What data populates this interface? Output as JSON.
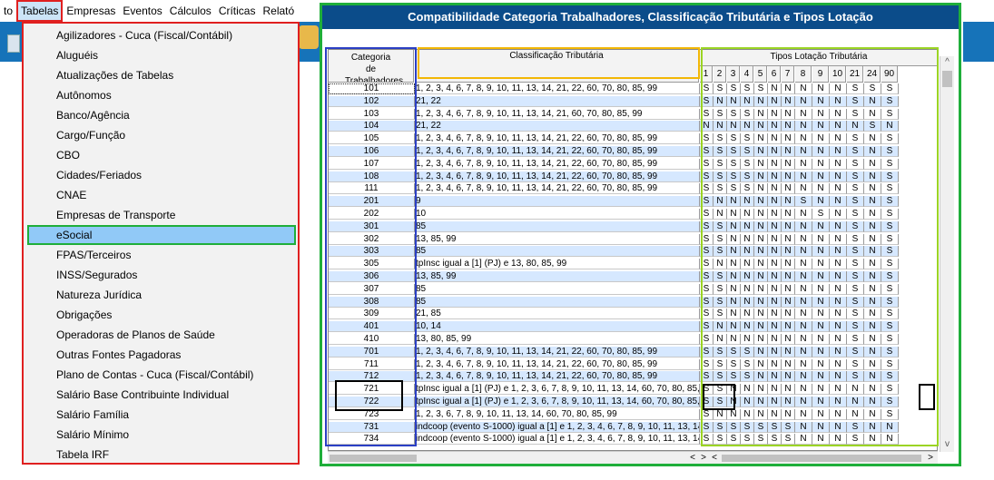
{
  "menubar": {
    "items": [
      "to",
      "Tabelas",
      "Empresas",
      "Eventos",
      "Cálculos",
      "Críticas",
      "Relató"
    ],
    "active": "Tabelas"
  },
  "menu": {
    "items": [
      "Agilizadores - Cuca (Fiscal/Contábil)",
      "Aluguéis",
      "Atualizações de Tabelas",
      "Autônomos",
      "Banco/Agência",
      "Cargo/Função",
      "CBO",
      "Cidades/Feriados",
      "CNAE",
      "Empresas de Transporte",
      "eSocial",
      "FPAS/Terceiros",
      "INSS/Segurados",
      "Natureza Jurídica",
      "Obrigações",
      "Operadoras de Planos de Saúde",
      "Outras Fontes Pagadoras",
      "Plano de Contas - Cuca (Fiscal/Contábil)",
      "Salário Base Contribuinte Individual",
      "Salário Família",
      "Salário Mínimo",
      "Tabela IRF"
    ],
    "selected_index": 10
  },
  "dialog": {
    "title": "Compatibilidade Categoria Trabalhadores, Classificação Tributária e Tipos Lotação",
    "col_categoria": "Categoria de Trabalhadores",
    "col_classificacao": "Classificação Tributária",
    "col_tipos": "Tipos Lotação Tributária",
    "tipos": [
      "1",
      "2",
      "3",
      "4",
      "5",
      "6",
      "7",
      "8",
      "9",
      "10",
      "21",
      "24",
      "90"
    ],
    "rows": [
      {
        "cat": "101",
        "cls": "1, 2, 3, 4, 6, 7, 8, 9, 10, 11, 13, 14, 21, 22, 60, 70, 80, 85, 99",
        "v": "SSSSSNNNNNSSS"
      },
      {
        "cat": "102",
        "cls": "21, 22",
        "v": "SNNNNNNNNNSNS"
      },
      {
        "cat": "103",
        "cls": "1, 2, 3, 4, 6, 7, 8, 9, 10, 11, 13, 14, 21, 60, 70, 80, 85, 99",
        "v": "SSSSNNNNNNSNS"
      },
      {
        "cat": "104",
        "cls": "21, 22",
        "v": "NNNNNNNNNNNSN"
      },
      {
        "cat": "105",
        "cls": "1, 2, 3, 4, 6, 7, 8, 9, 10, 11, 13, 14, 21, 22, 60, 70, 80, 85, 99",
        "v": "SSSSNNNNNNSNS"
      },
      {
        "cat": "106",
        "cls": "1, 2, 3, 4, 6, 7, 8, 9, 10, 11, 13, 14, 21, 22, 60, 70, 80, 85, 99",
        "v": "SSSSNNNNNNSNS"
      },
      {
        "cat": "107",
        "cls": "1, 2, 3, 4, 6, 7, 8, 9, 10, 11, 13, 14, 21, 22, 60, 70, 80, 85, 99",
        "v": "SSSSNNNNNNSNS"
      },
      {
        "cat": "108",
        "cls": "1, 2, 3, 4, 6, 7, 8, 9, 10, 11, 13, 14, 21, 22, 60, 70, 80, 85, 99",
        "v": "SSSSNNNNNNSNS"
      },
      {
        "cat": "111",
        "cls": "1, 2, 3, 4, 6, 7, 8, 9, 10, 11, 13, 14, 21, 22, 60, 70, 80, 85, 99",
        "v": "SSSSNNNNNNSNS"
      },
      {
        "cat": "201",
        "cls": "9",
        "v": "SNNNNNNSNNSNS"
      },
      {
        "cat": "202",
        "cls": "10",
        "v": "SNNNNNNNSNSNS"
      },
      {
        "cat": "301",
        "cls": "85",
        "v": "SSNNNNNNNNSNS"
      },
      {
        "cat": "302",
        "cls": "13, 85, 99",
        "v": "SSNNNNNNNNSNS"
      },
      {
        "cat": "303",
        "cls": "85",
        "v": "SSNNNNNNNNSNS"
      },
      {
        "cat": "305",
        "cls": "tpInsc igual a [1] (PJ) e 13, 80, 85, 99",
        "v": "SNNNNNNNNNSNS"
      },
      {
        "cat": "306",
        "cls": "13, 85, 99",
        "v": "SSNNNNNNNNSNS"
      },
      {
        "cat": "307",
        "cls": "85",
        "v": "SSNNNNNNNNSNS"
      },
      {
        "cat": "308",
        "cls": "85",
        "v": "SSNNNNNNNNSNS"
      },
      {
        "cat": "309",
        "cls": "21, 85",
        "v": "SSNNNNNNNNSNS"
      },
      {
        "cat": "401",
        "cls": "10, 14",
        "v": "SNNNNNNNNNSNS"
      },
      {
        "cat": "410",
        "cls": "13, 80, 85, 99",
        "v": "SNNNNNNNNNSNS"
      },
      {
        "cat": "701",
        "cls": "1, 2, 3, 4, 6, 7, 8, 9, 10, 11, 13, 14, 21, 22, 60, 70, 80, 85, 99",
        "v": "SSSSNNNNNNSNS"
      },
      {
        "cat": "711",
        "cls": "1, 2, 3, 4, 6, 7, 8, 9, 10, 11, 13, 14, 21, 22, 60, 70, 80, 85, 99",
        "v": "SSSSNNNNNNSNS"
      },
      {
        "cat": "712",
        "cls": "1, 2, 3, 4, 6, 7, 8, 9, 10, 11, 13, 14, 21, 22, 60, 70, 80, 85, 99",
        "v": "SSSSNNNNNNSNS"
      },
      {
        "cat": "721",
        "cls": "tpInsc igual a [1] (PJ) e 1, 2, 3, 6, 7, 8, 9, 10, 11, 13, 14, 60, 70, 80, 85, 99",
        "v": "SSNNNNNNNNNNS"
      },
      {
        "cat": "722",
        "cls": "tpInsc igual a [1] (PJ) e 1, 2, 3, 6, 7, 8, 9, 10, 11, 13, 14, 60, 70, 80, 85, 99",
        "v": "SSNNNNNNNNNNS"
      },
      {
        "cat": "723",
        "cls": "1, 2, 3, 6, 7, 8, 9, 10, 11, 13, 14, 60, 70, 80, 85, 99",
        "v": "SNNNNNNNNNNNS"
      },
      {
        "cat": "731",
        "cls": "indcoop (evento S-1000) igual a [1] e 1, 2, 3, 4, 6, 7, 8, 9, 10, 11, 13, 14, 21, 22",
        "v": "SSSSSSSNNNSNN"
      },
      {
        "cat": "734",
        "cls": "indcoop (evento S-1000) igual a [1] e 1, 2, 3, 4, 6, 7, 8, 9, 10, 11, 13, 14, 21, 22",
        "v": "SSSSSSSNNNSNN"
      }
    ]
  },
  "scroll": {
    "up": "^",
    "down": "v",
    "left": "<",
    "right": ">"
  },
  "colors": {
    "menu_border": "#e02020",
    "selection_border": "#1fae3a",
    "title_bg": "#0b4c8a",
    "row_alt": "#d6e8ff",
    "categoria_highlight": "#2b3fc4",
    "classificacao_highlight": "#f2b705",
    "tipos_highlight": "#9bd424"
  }
}
